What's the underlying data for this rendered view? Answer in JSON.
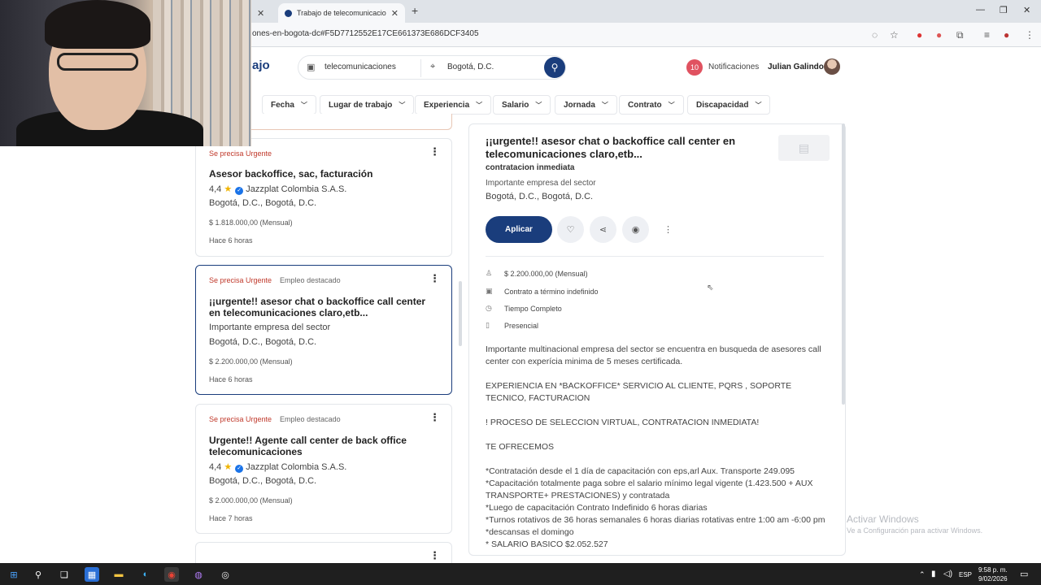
{
  "browser": {
    "tab_title": "Trabajo de telecomunicaciones",
    "url": "ones-en-bogota-dc#F5D7712552E17CE661373E686DCF3405"
  },
  "header": {
    "logo_text": "ajo",
    "search_query": "telecomunicaciones",
    "location": "Bogotá, D.C.",
    "notifications_count": "10",
    "notifications_label": "Notificaciones",
    "user_name": "Julian Galindo"
  },
  "filters": [
    "Fecha",
    "Lugar de trabajo",
    "Experiencia",
    "Salario",
    "Jornada",
    "Contrato",
    "Discapacidad"
  ],
  "cards": [
    {
      "urgent": "Se precisa Urgente",
      "featured": "",
      "title": "Asesor backoffice, sac, facturación",
      "rating": "4,4",
      "company": "Jazzplat Colombia S.A.S.",
      "location": "Bogotá, D.C., Bogotá, D.C.",
      "salary": "$ 1.818.000,00 (Mensual)",
      "posted": "Hace 6 horas"
    },
    {
      "urgent": "Se precisa Urgente",
      "featured": "Empleo destacado",
      "title": "¡¡urgente!! asesor chat o backoffice call center en telecomunicaciones claro,etb...",
      "company": "Importante empresa del sector",
      "location": "Bogotá, D.C., Bogotá, D.C.",
      "salary": "$ 2.200.000,00 (Mensual)",
      "posted": "Hace 6 horas"
    },
    {
      "urgent": "Se precisa Urgente",
      "featured": "Empleo destacado",
      "title": "Urgente!! Agente call center de back office telecomunicaciones",
      "rating": "4,4",
      "company": "Jazzplat Colombia S.A.S.",
      "location": "Bogotá, D.C., Bogotá, D.C.",
      "salary": "$ 2.000.000,00 (Mensual)",
      "posted": "Hace 7 horas"
    }
  ],
  "detail": {
    "title": "¡¡urgente!! asesor chat o backoffice call center en telecomunicaciones claro,etb...",
    "subtitle": "contratacion inmediata",
    "company": "Importante empresa del sector",
    "location": "Bogotá, D.C., Bogotá, D.C.",
    "apply_label": "Aplicar",
    "salary": "$ 2.200.000,00 (Mensual)",
    "contract": "Contrato a término indefinido",
    "schedule": "Tiempo Completo",
    "modality": "Presencial",
    "description": [
      "Importante multinacional empresa del sector se encuentra en busqueda de asesores call center con experícia minima de 5 meses certificada.",
      "EXPERIENCIA EN *BACKOFFICE* SERVICIO AL CLIENTE, PQRS , SOPORTE TECNICO, FACTURACION",
      "! PROCESO DE SELECCION VIRTUAL, CONTRATACION INMEDIATA!",
      "TE OFRECEMOS",
      "*Contratación desde el 1 día de capacitación con eps,arl Aux. Transporte 249.095",
      "*Capacitación totalmente paga sobre el salario mínimo legal vigente (1.423.500 + AUX TRANSPORTE+ PRESTACIONES) y contratada",
      "*Luego de capacitación Contrato Indefinido 6 horas diarias",
      "*Turnos rotativos de 36 horas semanales 6 horas diarias rotativas entre 1:00 am -6:00 pm",
      "*descansas el domingo",
      "* SALARIO BASICO $2.052.527"
    ]
  },
  "watermark": {
    "title": "Activar Windows",
    "subtitle": "Ve a Configuración para activar Windows."
  },
  "taskbar": {
    "lang": "ESP",
    "time": "9:58 p. m.",
    "date": "9/02/2026"
  }
}
